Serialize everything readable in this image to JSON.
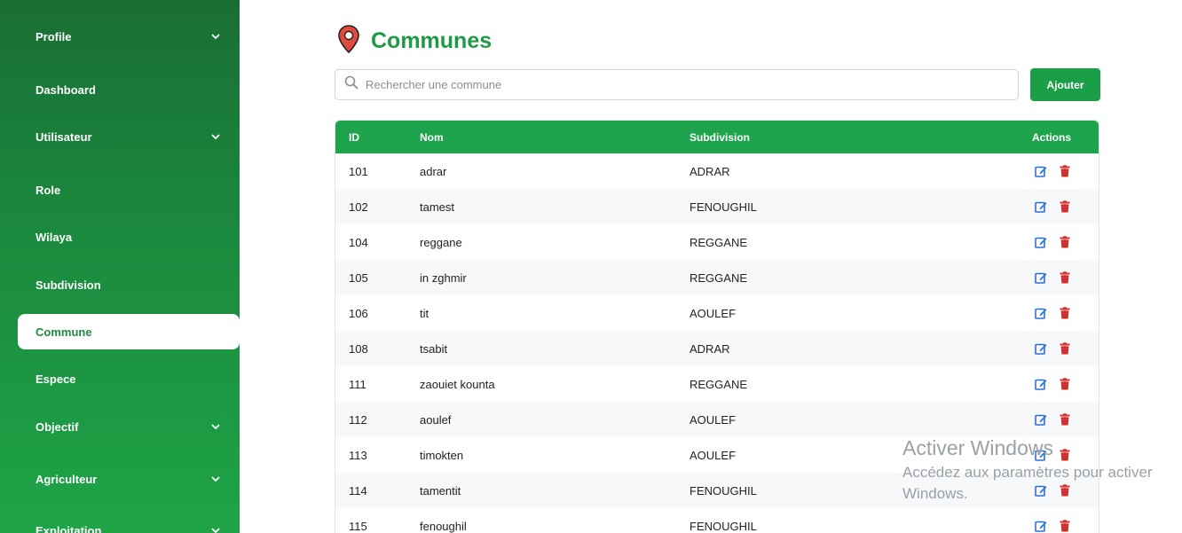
{
  "sidebar": {
    "items": [
      {
        "label": "Profile",
        "has_chevron": true
      },
      {
        "label": "Dashboard",
        "has_chevron": false
      },
      {
        "label": "Utilisateur",
        "has_chevron": true
      },
      {
        "label": "Role",
        "has_chevron": false
      },
      {
        "label": "Wilaya",
        "has_chevron": false
      },
      {
        "label": "Subdivision",
        "has_chevron": false
      },
      {
        "label": "Commune",
        "has_chevron": false,
        "active": true
      },
      {
        "label": "Espece",
        "has_chevron": false
      },
      {
        "label": "Objectif",
        "has_chevron": true
      },
      {
        "label": "Agriculteur",
        "has_chevron": true
      },
      {
        "label": "Exploitation",
        "has_chevron": true
      }
    ]
  },
  "page": {
    "title": "Communes",
    "icon": "map-pin-icon"
  },
  "search": {
    "placeholder": "Rechercher une commune",
    "value": ""
  },
  "toolbar": {
    "add_label": "Ajouter"
  },
  "table": {
    "headers": {
      "id": "ID",
      "nom": "Nom",
      "subdivision": "Subdivision",
      "actions": "Actions"
    },
    "rows": [
      {
        "id": "101",
        "nom": "adrar",
        "subdivision": "ADRAR"
      },
      {
        "id": "102",
        "nom": "tamest",
        "subdivision": "FENOUGHIL"
      },
      {
        "id": "104",
        "nom": "reggane",
        "subdivision": "REGGANE"
      },
      {
        "id": "105",
        "nom": "in zghmir",
        "subdivision": "REGGANE"
      },
      {
        "id": "106",
        "nom": "tit",
        "subdivision": "AOULEF"
      },
      {
        "id": "108",
        "nom": "tsabit",
        "subdivision": "ADRAR"
      },
      {
        "id": "111",
        "nom": "zaouiet kounta",
        "subdivision": "REGGANE"
      },
      {
        "id": "112",
        "nom": "aoulef",
        "subdivision": "AOULEF"
      },
      {
        "id": "113",
        "nom": "timokten",
        "subdivision": "AOULEF"
      },
      {
        "id": "114",
        "nom": "tamentit",
        "subdivision": "FENOUGHIL"
      },
      {
        "id": "115",
        "nom": "fenoughil",
        "subdivision": "FENOUGHIL"
      }
    ]
  },
  "watermark": {
    "title": "Activer Windows",
    "line1": "Accédez aux paramètres pour activer",
    "line2": "Windows."
  },
  "colors": {
    "brand_green": "#1e9a46",
    "edit_blue": "#2a6fd6",
    "delete_red": "#d32f2f"
  }
}
